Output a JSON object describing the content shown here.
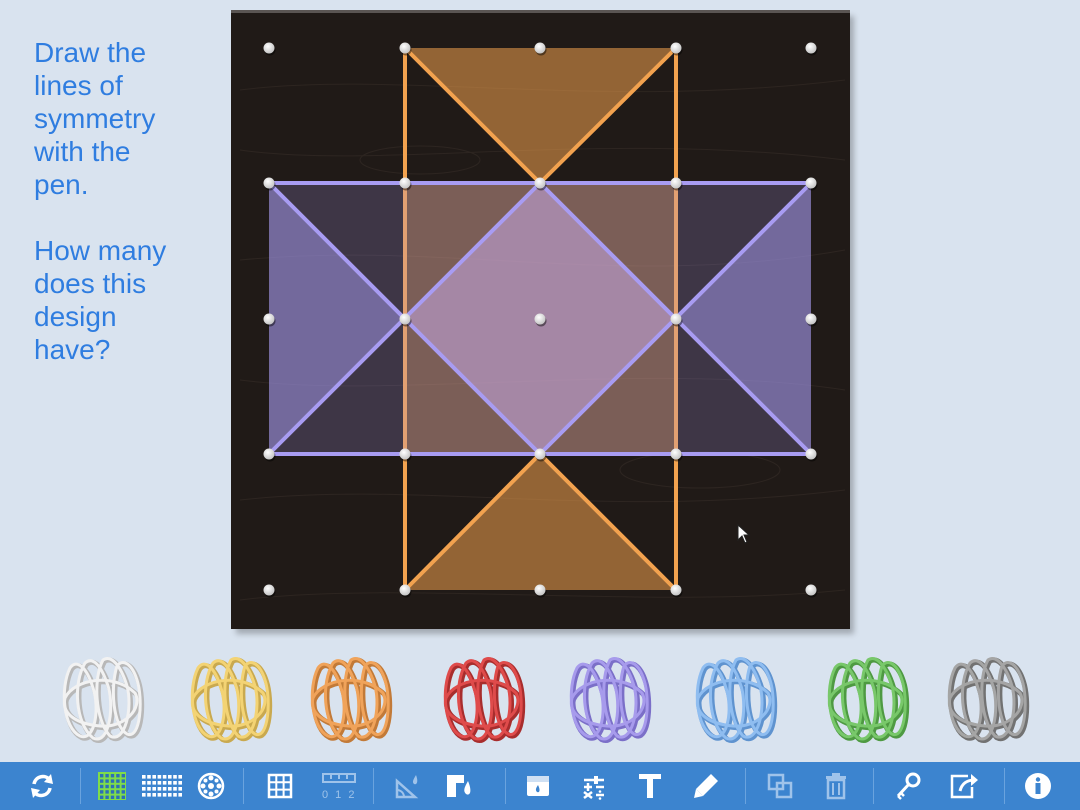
{
  "instructions": {
    "line1": "Draw the",
    "line2": "lines of",
    "line3": "symmetry",
    "line4": "with the",
    "line5": "pen.",
    "q1": "How many",
    "q2": "does this",
    "q3": "design",
    "q4": "have?"
  },
  "bands": [
    {
      "color_name": "white",
      "stroke": "#f2f2f2",
      "shadow": "#b8b8b8"
    },
    {
      "color_name": "yellow",
      "stroke": "#f3d374",
      "shadow": "#c9a94f"
    },
    {
      "color_name": "orange",
      "stroke": "#f0a35a",
      "shadow": "#c27a38"
    },
    {
      "color_name": "red",
      "stroke": "#df4b4b",
      "shadow": "#a82d2d"
    },
    {
      "color_name": "purple",
      "stroke": "#a79bec",
      "shadow": "#7b6fc8"
    },
    {
      "color_name": "blue",
      "stroke": "#8fbdf0",
      "shadow": "#5f93cf"
    },
    {
      "color_name": "green",
      "stroke": "#78c86a",
      "shadow": "#4e9a42"
    },
    {
      "color_name": "gray",
      "stroke": "#a5a5a5",
      "shadow": "#727272"
    }
  ],
  "shapes": {
    "orange_color": "#f2a24f",
    "purple_color": "#a89cf2"
  },
  "toolbar": {
    "number_line_label": "0 1 2",
    "icons": [
      "refresh-icon",
      "square-grid-icon",
      "rectangle-grid-icon",
      "circle-geoboard-icon",
      "grid-lines-icon",
      "number-line-icon",
      "measure-angle-icon",
      "fill-shape-icon",
      "background-icon",
      "calculator-icon",
      "text-icon",
      "pen-icon",
      "duplicate-icon",
      "trash-icon",
      "key-icon",
      "share-icon",
      "info-icon"
    ]
  }
}
